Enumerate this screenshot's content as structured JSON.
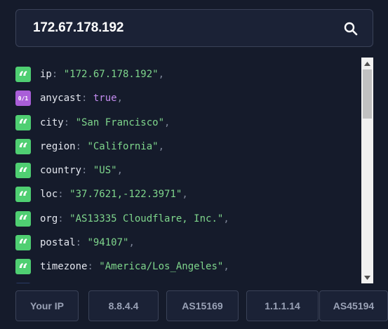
{
  "search": {
    "value": "172.67.178.192"
  },
  "json_rows": [
    {
      "key": "ip",
      "type": "string",
      "value": "\"172.67.178.192\""
    },
    {
      "key": "anycast",
      "type": "boolean",
      "value": "true"
    },
    {
      "key": "city",
      "type": "string",
      "value": "\"San Francisco\""
    },
    {
      "key": "region",
      "type": "string",
      "value": "\"California\""
    },
    {
      "key": "country",
      "type": "string",
      "value": "\"US\""
    },
    {
      "key": "loc",
      "type": "string",
      "value": "\"37.7621,-122.3971\""
    },
    {
      "key": "org",
      "type": "string",
      "value": "\"AS13335 Cloudflare, Inc.\""
    },
    {
      "key": "postal",
      "type": "string",
      "value": "\"94107\""
    },
    {
      "key": "timezone",
      "type": "string",
      "value": "\"America/Los_Angeles\""
    }
  ],
  "badges": {
    "string": "string-quote-icon",
    "boolean_label": "0/1"
  },
  "quick_buttons": [
    {
      "label": "Your IP"
    },
    {
      "label": "8.8.4.4"
    },
    {
      "label": "AS15169"
    },
    {
      "label": "1.1.1.14"
    },
    {
      "label": "AS45194"
    }
  ],
  "colors": {
    "background": "#151b2b",
    "string_badge": "#4fcf72",
    "boolean_badge": "#a95ed8",
    "string_value": "#7fd68c",
    "boolean_value": "#c48cf0"
  }
}
